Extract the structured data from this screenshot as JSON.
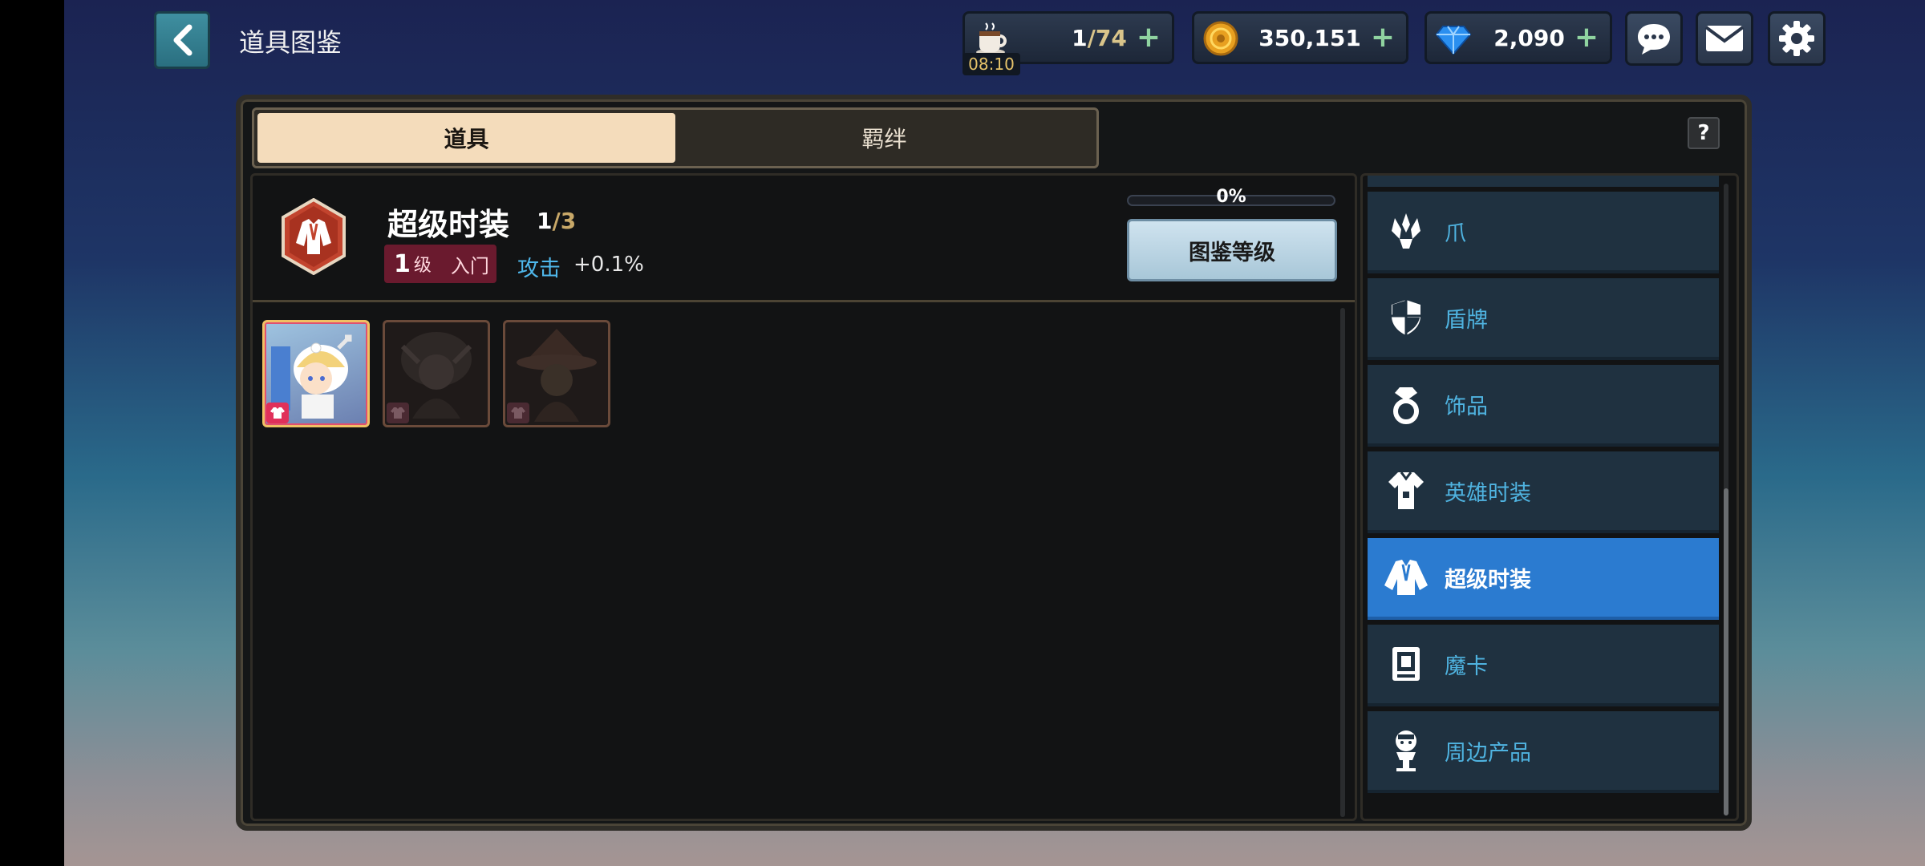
{
  "header": {
    "title": "道具图鉴",
    "stamina": {
      "current": "1",
      "max": "/74",
      "timer": "08:10"
    },
    "gold": "350,151",
    "gems": "2,090",
    "plus": "+"
  },
  "tabs": [
    {
      "label": "道具",
      "active": true
    },
    {
      "label": "羁绊",
      "active": false
    }
  ],
  "help_label": "?",
  "detail": {
    "title": "超级时装",
    "collected": "1",
    "total": "/3",
    "level_num": "1",
    "level_unit": "级",
    "level_name": "入门",
    "stat_name": "攻击",
    "stat_value": "+0.1%",
    "progress_label": "0%",
    "progress": 0,
    "level_button": "图鉴等级"
  },
  "items": [
    {
      "state": "owned"
    },
    {
      "state": "locked"
    },
    {
      "state": "locked"
    }
  ],
  "categories": [
    {
      "label": "爪",
      "icon": "claw-icon",
      "active": false
    },
    {
      "label": "盾牌",
      "icon": "shield-icon",
      "active": false
    },
    {
      "label": "饰品",
      "icon": "ring-icon",
      "active": false
    },
    {
      "label": "英雄时装",
      "icon": "hero-outfit-icon",
      "active": false
    },
    {
      "label": "超级时装",
      "icon": "super-outfit-icon",
      "active": true
    },
    {
      "label": "魔卡",
      "icon": "card-icon",
      "active": false
    },
    {
      "label": "周边产品",
      "icon": "merch-icon",
      "active": false
    }
  ],
  "colors": {
    "accent_blue": "#2b7bd0",
    "label_blue": "#4fb3e0",
    "badge_red": "#6a1a2e"
  }
}
